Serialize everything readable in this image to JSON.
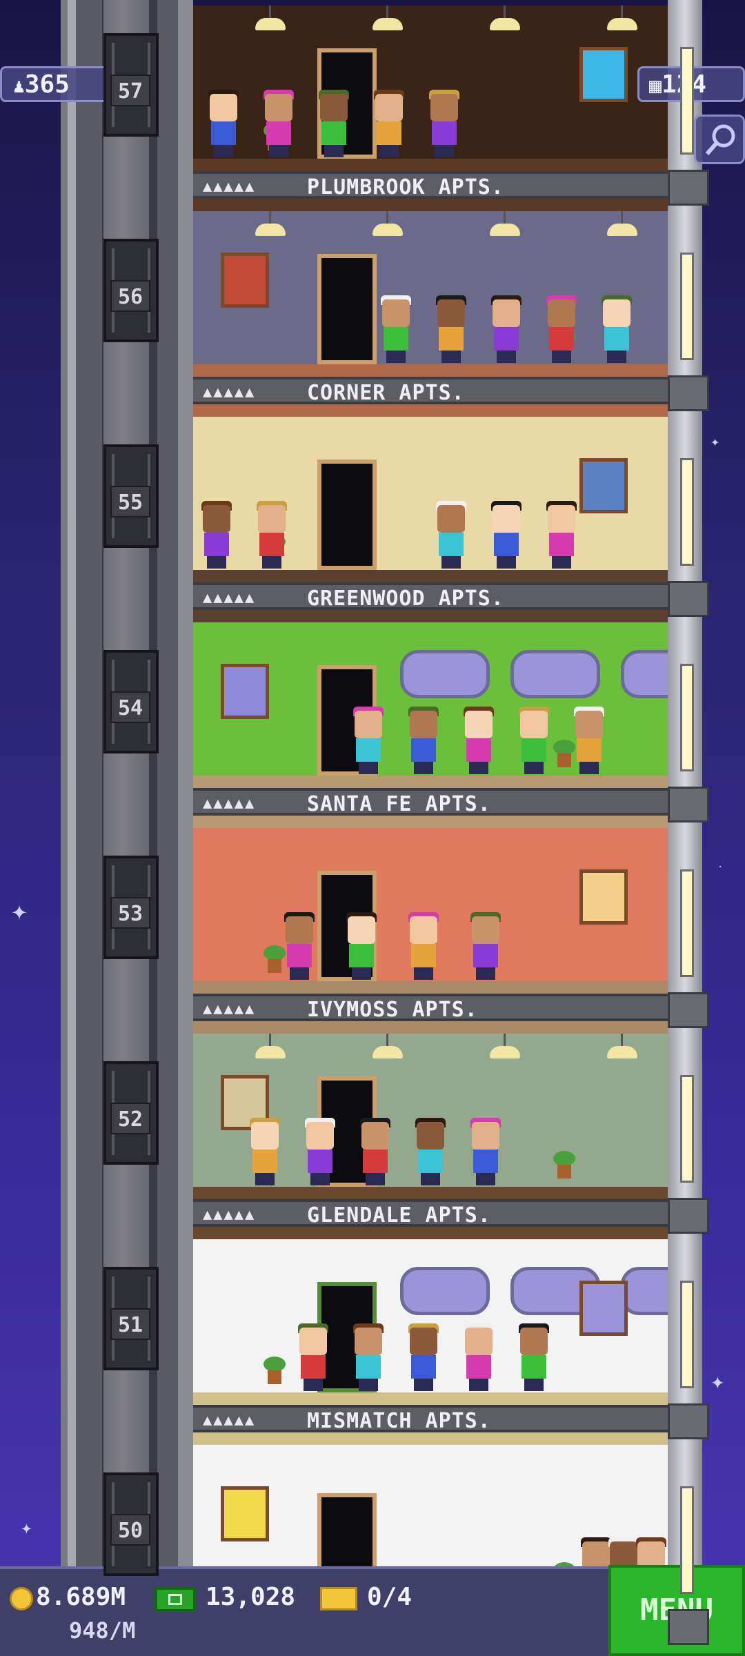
{
  "hud": {
    "population": "365",
    "floors": "124",
    "population_icon": "person-icon",
    "floors_icon": "building-icon",
    "search_icon": "magnifier-icon"
  },
  "floors": [
    {
      "number": "57",
      "name": "PLUMBROOK APTS.",
      "residents": "▲▲▲▲▲"
    },
    {
      "number": "56",
      "name": "CORNER APTS.",
      "residents": "▲▲▲▲▲"
    },
    {
      "number": "55",
      "name": "GREENWOOD APTS.",
      "residents": "▲▲▲▲▲"
    },
    {
      "number": "54",
      "name": "SANTA FE APTS.",
      "residents": "▲▲▲▲▲"
    },
    {
      "number": "53",
      "name": "IVYMOSS APTS.",
      "residents": "▲▲▲▲▲"
    },
    {
      "number": "52",
      "name": "GLENDALE APTS.",
      "residents": "▲▲▲▲▲"
    },
    {
      "number": "51",
      "name": "MISMATCH APTS.",
      "residents": "▲▲▲▲▲"
    },
    {
      "number": "50",
      "name": "",
      "residents": ""
    }
  ],
  "bottom": {
    "coins": "8.689M",
    "coin_rate": "948/M",
    "bux": "13,028",
    "tickets": "0/4",
    "menu_label": "MENU"
  },
  "colors": {
    "background": "#2a2470",
    "menu_button": "#2bb52b",
    "name_bar": "#5d5d66"
  }
}
